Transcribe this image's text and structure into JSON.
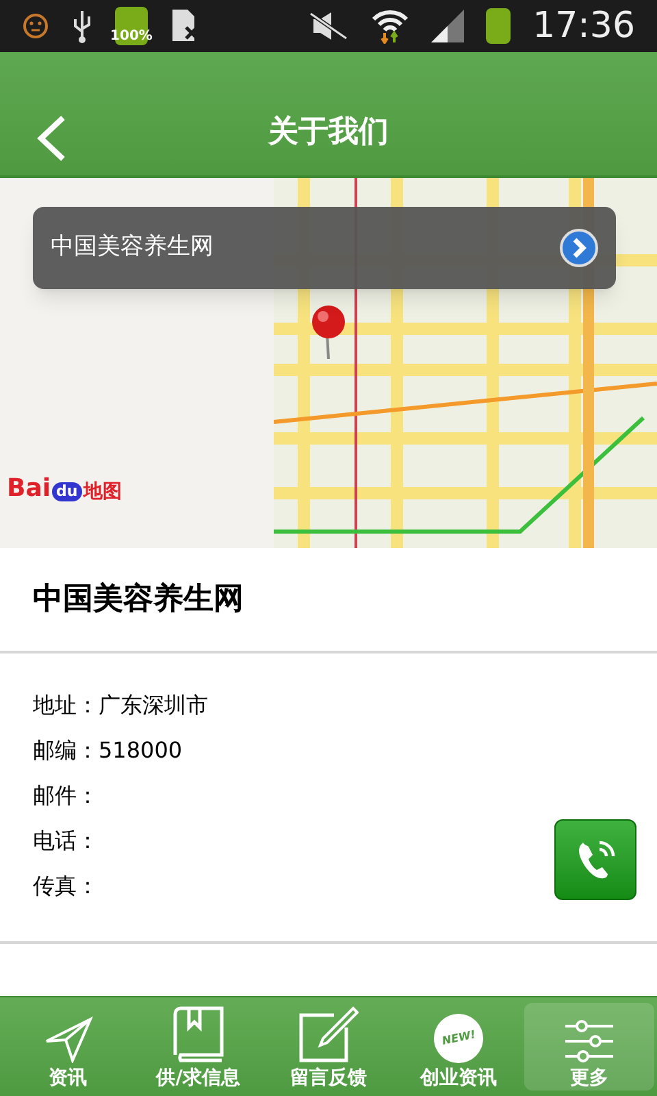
{
  "status_bar": {
    "battery_text": "100%",
    "time": "17:36"
  },
  "header": {
    "title": "关于我们"
  },
  "map": {
    "popup_title": "中国美容养生网",
    "logo": {
      "brand": "Bai",
      "paw": "du",
      "suffix": "地图"
    }
  },
  "company": {
    "name": "中国美容养生网"
  },
  "contact": [
    {
      "label": "地址：",
      "value": "广东深圳市"
    },
    {
      "label": "邮编：",
      "value": "518000"
    },
    {
      "label": "邮件："
    },
    {
      "label": "电话："
    },
    {
      "label": "传真："
    }
  ],
  "tabs": [
    {
      "label": "资讯",
      "kind": "plane",
      "selected": false
    },
    {
      "label": "供/求信息",
      "kind": "book",
      "selected": false
    },
    {
      "label": "留言反馈",
      "kind": "edit",
      "selected": false
    },
    {
      "label": "创业资讯",
      "kind": "new",
      "selected": false,
      "badge": "NEW!"
    },
    {
      "label": "更多",
      "kind": "sliders",
      "selected": true
    }
  ]
}
